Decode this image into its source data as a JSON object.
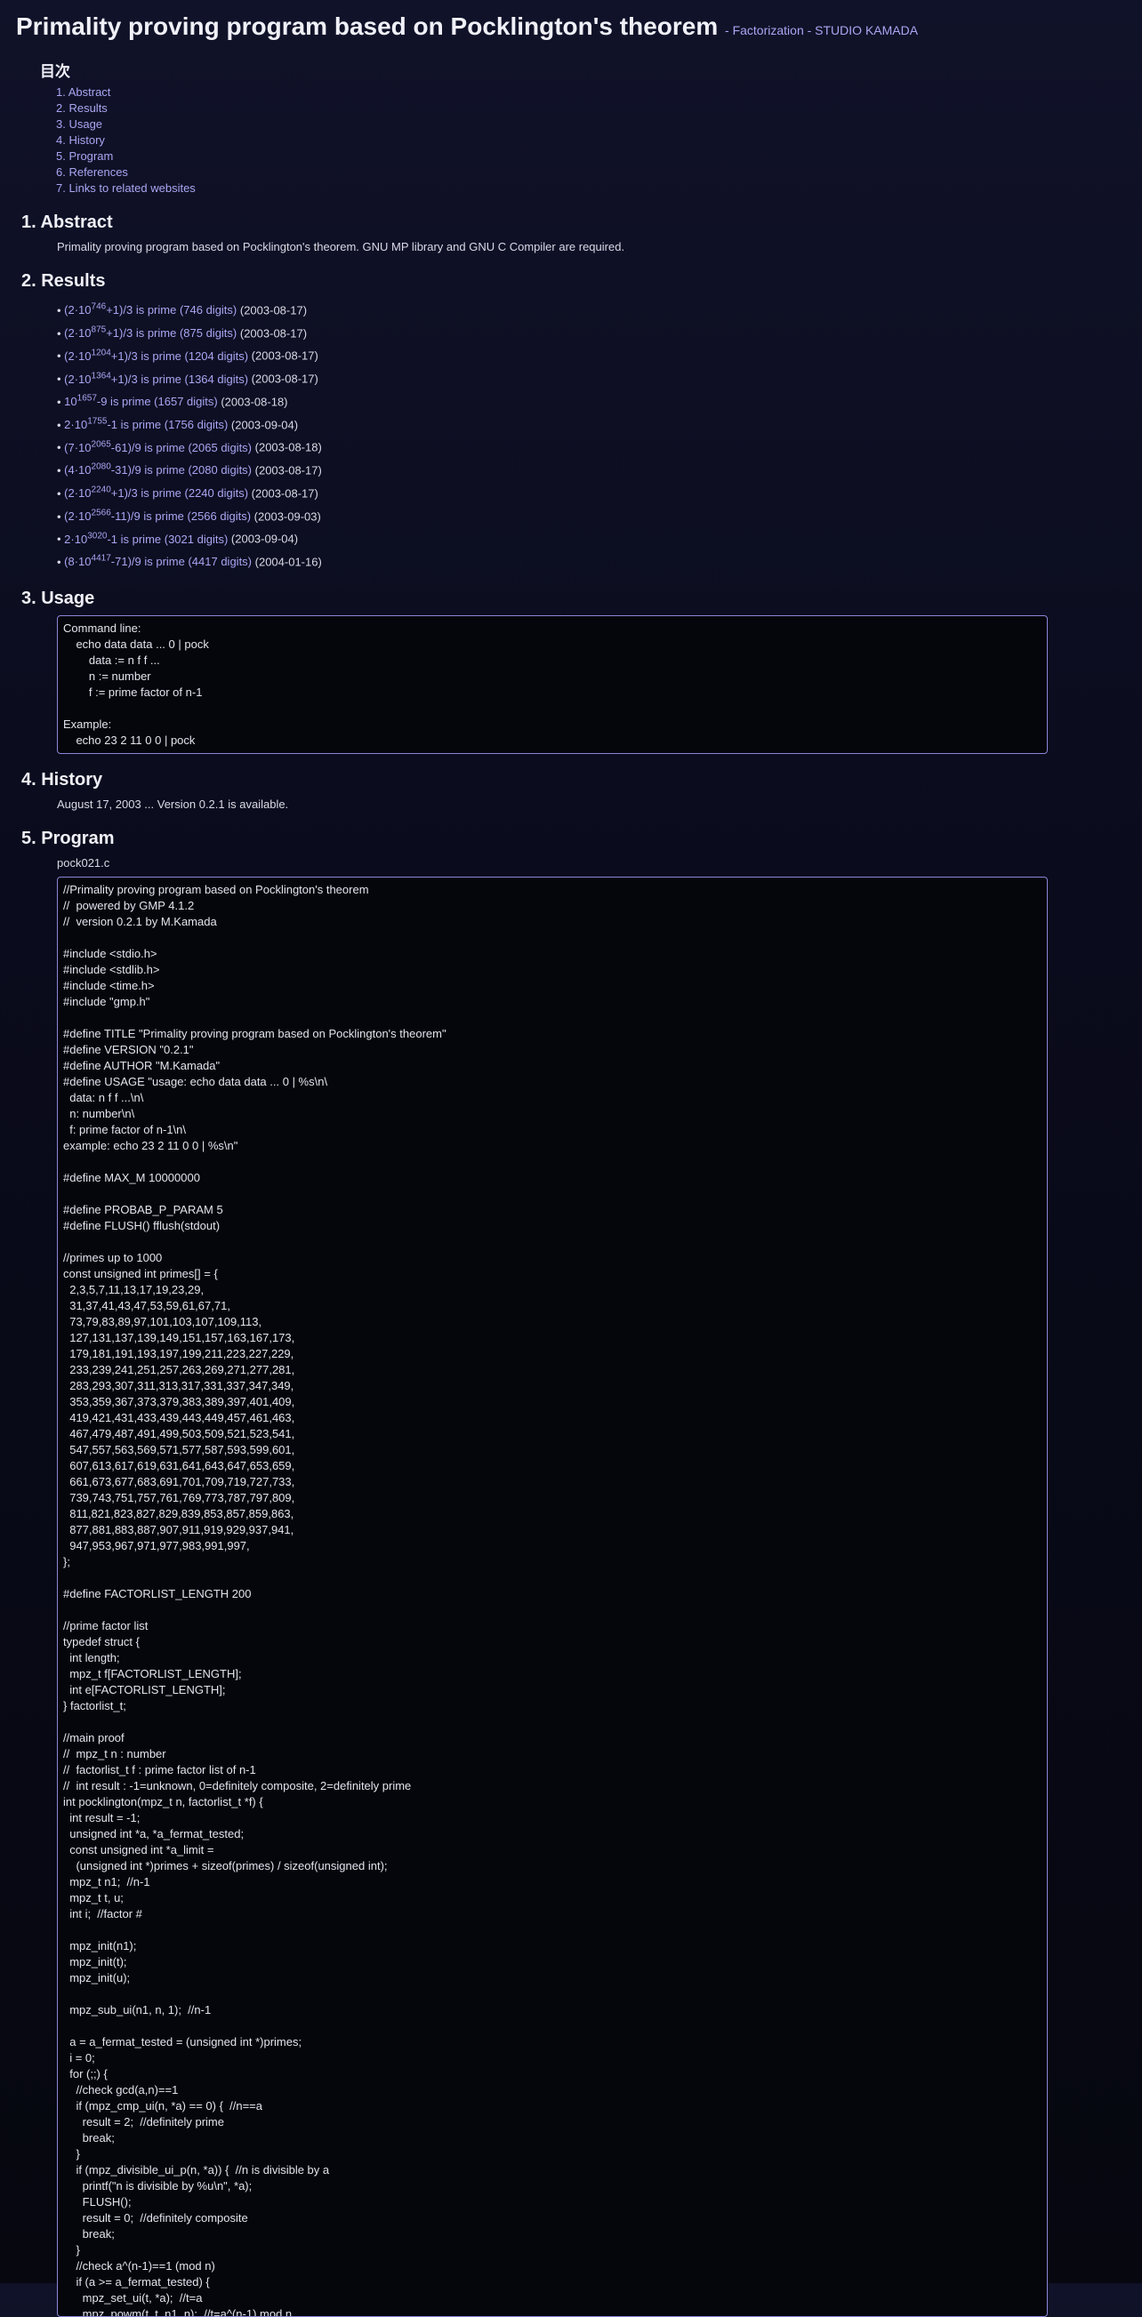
{
  "header": {
    "title": "Primality proving program based on Pocklington's theorem",
    "breadcrumb": "- Factorization - STUDIO KAMADA"
  },
  "toc": {
    "heading": "目次",
    "items": [
      "1. Abstract",
      "2. Results",
      "3. Usage",
      "4. History",
      "5. Program",
      "6. References",
      "7. Links to related websites"
    ]
  },
  "abstract": {
    "heading": "1. Abstract",
    "text": "Primality proving program based on Pocklington's theorem. GNU MP library and GNU C Compiler are required."
  },
  "results": {
    "heading": "2. Results",
    "items": [
      {
        "pre": "(2·10",
        "exp": "746",
        "post": "+1)/3 is prime (746 digits)",
        "date": "(2003-08-17)"
      },
      {
        "pre": "(2·10",
        "exp": "875",
        "post": "+1)/3 is prime (875 digits)",
        "date": "(2003-08-17)"
      },
      {
        "pre": "(2·10",
        "exp": "1204",
        "post": "+1)/3 is prime (1204 digits)",
        "date": "(2003-08-17)"
      },
      {
        "pre": "(2·10",
        "exp": "1364",
        "post": "+1)/3 is prime (1364 digits)",
        "date": "(2003-08-17)"
      },
      {
        "pre": "10",
        "exp": "1657",
        "post": "-9 is prime (1657 digits)",
        "date": "(2003-08-18)"
      },
      {
        "pre": "2·10",
        "exp": "1755",
        "post": "-1 is prime (1756 digits)",
        "date": "(2003-09-04)"
      },
      {
        "pre": "(7·10",
        "exp": "2065",
        "post": "-61)/9 is prime (2065 digits)",
        "date": "(2003-08-18)"
      },
      {
        "pre": "(4·10",
        "exp": "2080",
        "post": "-31)/9 is prime (2080 digits)",
        "date": "(2003-08-17)"
      },
      {
        "pre": "(2·10",
        "exp": "2240",
        "post": "+1)/3 is prime (2240 digits)",
        "date": "(2003-08-17)"
      },
      {
        "pre": "(2·10",
        "exp": "2566",
        "post": "-11)/9 is prime (2566 digits)",
        "date": "(2003-09-03)"
      },
      {
        "pre": "2·10",
        "exp": "3020",
        "post": "-1 is prime (3021 digits)",
        "date": "(2003-09-04)"
      },
      {
        "pre": "(8·10",
        "exp": "4417",
        "post": "-71)/9 is prime (4417 digits)",
        "date": "(2004-01-16)"
      }
    ]
  },
  "usage": {
    "heading": "3. Usage",
    "code": "Command line:\n    echo data data ... 0 | pock\n        data := n f f ...\n        n := number\n        f := prime factor of n-1\n\nExample:\n    echo 23 2 11 0 0 | pock"
  },
  "history": {
    "heading": "4. History",
    "text": "August 17, 2003 ... Version 0.2.1 is available."
  },
  "program": {
    "heading": "5. Program",
    "filename": "pock021.c",
    "code": "//Primality proving program based on Pocklington's theorem\n//  powered by GMP 4.1.2\n//  version 0.2.1 by M.Kamada\n\n#include <stdio.h>\n#include <stdlib.h>\n#include <time.h>\n#include \"gmp.h\"\n\n#define TITLE \"Primality proving program based on Pocklington's theorem\"\n#define VERSION \"0.2.1\"\n#define AUTHOR \"M.Kamada\"\n#define USAGE \"usage: echo data data ... 0 | %s\\n\\\n  data: n f f ...\\n\\\n  n: number\\n\\\n  f: prime factor of n-1\\n\\\nexample: echo 23 2 11 0 0 | %s\\n\"\n\n#define MAX_M 10000000\n\n#define PROBAB_P_PARAM 5\n#define FLUSH() fflush(stdout)\n\n//primes up to 1000\nconst unsigned int primes[] = {\n  2,3,5,7,11,13,17,19,23,29,\n  31,37,41,43,47,53,59,61,67,71,\n  73,79,83,89,97,101,103,107,109,113,\n  127,131,137,139,149,151,157,163,167,173,\n  179,181,191,193,197,199,211,223,227,229,\n  233,239,241,251,257,263,269,271,277,281,\n  283,293,307,311,313,317,331,337,347,349,\n  353,359,367,373,379,383,389,397,401,409,\n  419,421,431,433,439,443,449,457,461,463,\n  467,479,487,491,499,503,509,521,523,541,\n  547,557,563,569,571,577,587,593,599,601,\n  607,613,617,619,631,641,643,647,653,659,\n  661,673,677,683,691,701,709,719,727,733,\n  739,743,751,757,761,769,773,787,797,809,\n  811,821,823,827,829,839,853,857,859,863,\n  877,881,883,887,907,911,919,929,937,941,\n  947,953,967,971,977,983,991,997,\n};\n\n#define FACTORLIST_LENGTH 200\n\n//prime factor list\ntypedef struct {\n  int length;\n  mpz_t f[FACTORLIST_LENGTH];\n  int e[FACTORLIST_LENGTH];\n} factorlist_t;\n\n//main proof\n//  mpz_t n : number\n//  factorlist_t f : prime factor list of n-1\n//  int result : -1=unknown, 0=definitely composite, 2=definitely prime\nint pocklington(mpz_t n, factorlist_t *f) {\n  int result = -1;\n  unsigned int *a, *a_fermat_tested;\n  const unsigned int *a_limit =\n    (unsigned int *)primes + sizeof(primes) / sizeof(unsigned int);\n  mpz_t n1;  //n-1\n  mpz_t t, u;\n  int i;  //factor #\n\n  mpz_init(n1);\n  mpz_init(t);\n  mpz_init(u);\n\n  mpz_sub_ui(n1, n, 1);  //n-1\n\n  a = a_fermat_tested = (unsigned int *)primes;\n  i = 0;\n  for (;;) {\n    //check gcd(a,n)==1\n    if (mpz_cmp_ui(n, *a) == 0) {  //n==a\n      result = 2;  //definitely prime\n      break;\n    }\n    if (mpz_divisible_ui_p(n, *a)) {  //n is divisible by a\n      printf(\"n is divisible by %u\\n\", *a);\n      FLUSH();\n      result = 0;  //definitely composite\n      break;\n    }\n    //check a^(n-1)==1 (mod n)\n    if (a >= a_fermat_tested) {\n      mpz_set_ui(t, *a);  //t=a\n      mpz_powm(t, t, n1, n);  //t=a^(n-1) mod n"
  }
}
